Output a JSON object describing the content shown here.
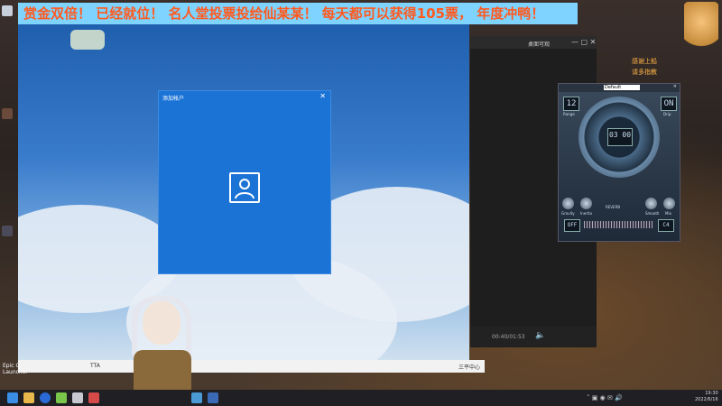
{
  "banner": {
    "text": "赏金双倍！ 已经就位！ 名人堂投票投给仙某某！ 每天都可以获得105票， 年度冲鸭！"
  },
  "desktop": {
    "epic_label_line1": "Epic Games",
    "epic_label_line2": "Launcher"
  },
  "dialog": {
    "title": "添加帐户"
  },
  "main_window": {
    "status_left": "TTA",
    "status_right": "三平中心"
  },
  "player": {
    "title": "桌面可观",
    "time": "00:40/01:53"
  },
  "plugin": {
    "preset_label": "Default",
    "predelay_value": "12",
    "predelay_label": "Range",
    "tail_value": "ON",
    "tail_label": "Drip",
    "dial_value": "03 00",
    "brand": "REVERB",
    "off_value": "OFF",
    "c4_value": "C4",
    "knob_labels": [
      "Gravity",
      "Inertia",
      "Smooth",
      "Mix"
    ]
  },
  "overlay_right": {
    "line1": "感谢上船",
    "line2": "请多指教"
  },
  "clock": {
    "time": "19:30",
    "date": "2022/6/16"
  }
}
